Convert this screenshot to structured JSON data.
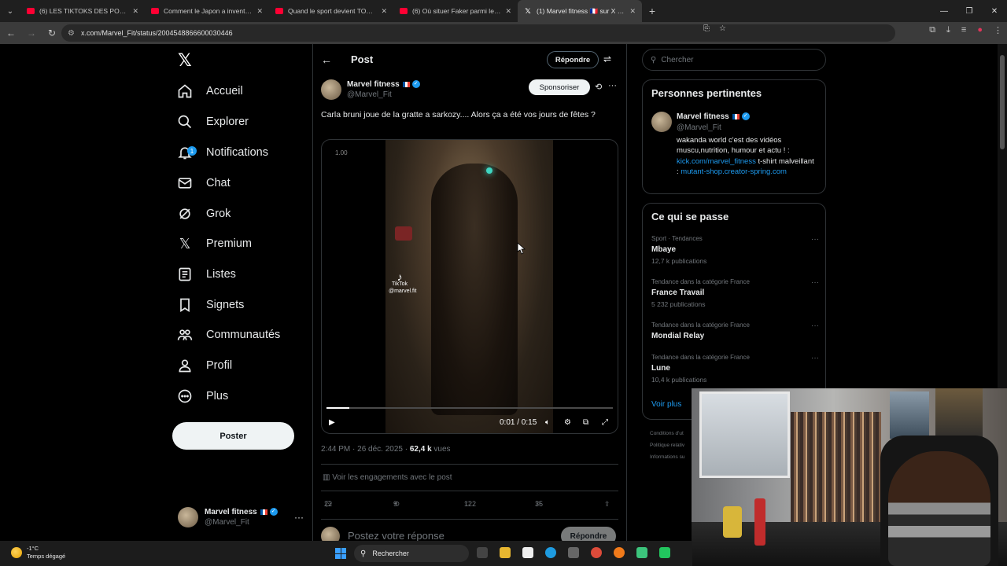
{
  "browser": {
    "tabs": [
      {
        "title": "(6) LES TIKTOKS DES POLITIQUE",
        "active": false,
        "favicon": "youtube-icon"
      },
      {
        "title": "Comment le Japon a inventé l'a",
        "active": false,
        "favicon": "youtube-icon"
      },
      {
        "title": "Quand le sport devient TOXIQUE",
        "active": false,
        "favicon": "youtube-icon"
      },
      {
        "title": "(6) Où situer Faker parmi les lég",
        "active": false,
        "favicon": "youtube-icon"
      },
      {
        "title": "(1) Marvel fitness 🇫🇷 sur X : \"Car",
        "active": true,
        "favicon": "x-icon"
      }
    ],
    "url": "x.com/Marvel_Fit/status/2004548866600030446"
  },
  "nav": {
    "items": [
      {
        "label": "Accueil",
        "icon": "home-icon"
      },
      {
        "label": "Explorer",
        "icon": "search-icon"
      },
      {
        "label": "Notifications",
        "icon": "bell-icon",
        "badge": "1"
      },
      {
        "label": "Chat",
        "icon": "mail-icon"
      },
      {
        "label": "Grok",
        "icon": "grok-icon"
      },
      {
        "label": "Premium",
        "icon": "x-logo-icon"
      },
      {
        "label": "Listes",
        "icon": "list-icon"
      },
      {
        "label": "Signets",
        "icon": "bookmark-icon"
      },
      {
        "label": "Communautés",
        "icon": "communities-icon"
      },
      {
        "label": "Profil",
        "icon": "profile-icon"
      },
      {
        "label": "Plus",
        "icon": "more-circle-icon"
      }
    ],
    "post_button": "Poster",
    "account": {
      "name": "Marvel fitness",
      "handle": "@Marvel_Fit"
    }
  },
  "main": {
    "title": "Post",
    "reply_button": "Répondre",
    "tweet": {
      "author_name": "Marvel fitness",
      "author_handle": "@Marvel_Fit",
      "sponsor_button": "Sponsoriser",
      "text": "Carla bruni joue de la gratte a sarkozy.... Alors ça a été vos jours de fêtes ?",
      "video": {
        "playback_rate": "1.00",
        "time": "0:01 / 0:15",
        "progress": 0.08,
        "watermark_brand": "TikTok",
        "watermark_handle": "@marvel.fit"
      },
      "timestamp": "2:44 PM · 26 déc. 2025 · ",
      "views": "62,4 k",
      "views_label": " vues",
      "engagements_link": "Voir les engagements avec le post",
      "stats": {
        "replies": "22",
        "reposts": "9",
        "likes": "122",
        "bookmarks": "35"
      }
    },
    "reply_placeholder": "Postez votre réponse",
    "reply_submit": "Répondre"
  },
  "sidebar": {
    "search_placeholder": "Chercher",
    "relevant_title": "Personnes pertinentes",
    "relevant_person": {
      "name": "Marvel fitness",
      "handle": "@Marvel_Fit",
      "bio_1": "wakanda world c'est des vidéos muscu,nutrition, humour et actu ! : ",
      "bio_link_1": "kick.com/marvel_fitness",
      "bio_2": " t-shirt malveillant : ",
      "bio_link_2": "mutant-shop.creator-spring.com"
    },
    "trends_title": "Ce qui se passe",
    "trends": [
      {
        "category": "Sport · Tendances",
        "name": "Mbaye",
        "count": "12,7 k publications"
      },
      {
        "category": "Tendance dans la catégorie France",
        "name": "France Travail",
        "count": "5 232 publications"
      },
      {
        "category": "Tendance dans la catégorie France",
        "name": "Mondial Relay",
        "count": ""
      },
      {
        "category": "Tendance dans la catégorie France",
        "name": "Lune",
        "count": "10,4 k publications"
      }
    ],
    "see_more": "Voir plus",
    "footer": [
      "Conditions d'ut",
      "Politique relativ",
      "Informations su"
    ]
  },
  "taskbar": {
    "temperature": "-1°C",
    "weather": "Temps dégagé",
    "search": "Rechercher"
  }
}
